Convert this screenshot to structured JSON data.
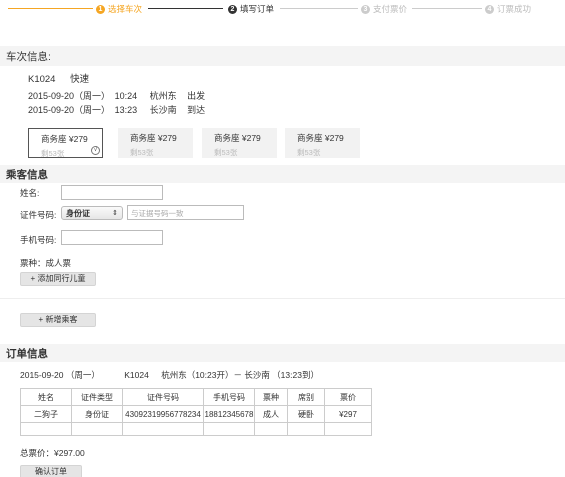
{
  "steps": [
    {
      "num": "1",
      "label": "选择车次",
      "state": "done"
    },
    {
      "num": "2",
      "label": "填写订单",
      "state": "active"
    },
    {
      "num": "3",
      "label": "支付票价",
      "state": "todo"
    },
    {
      "num": "4",
      "label": "订票成功",
      "state": "todo"
    }
  ],
  "colors": {
    "done": "#f5a623",
    "active": "#333333",
    "todo": "#cccccc"
  },
  "train": {
    "section_title": "车次信息:",
    "number": "K1024",
    "type": "快速",
    "depart_date": "2015-09-20（周一）",
    "depart_time": "10:24",
    "depart_station": "杭州东",
    "depart_action": "出发",
    "arrive_date": "2015-09-20（周一）",
    "arrive_time": "13:23",
    "arrive_station": "长沙南",
    "arrive_action": "到达"
  },
  "seats": [
    {
      "name": "商务座 ¥279",
      "remaining": "剩53张",
      "selected": true,
      "badge": "√"
    },
    {
      "name": "商务座 ¥279",
      "remaining": "剩53张"
    },
    {
      "name": "商务座 ¥279",
      "remaining": "剩53张"
    },
    {
      "name": "商务座 ¥279",
      "remaining": "剩53张"
    }
  ],
  "passenger": {
    "section_title": "乘客信息",
    "name_label": "姓名:",
    "name_value": "",
    "id_label": "证件号码:",
    "id_type": "身份证",
    "id_placeholder": "与证据号码一致",
    "phone_label": "手机号码:",
    "phone_value": "",
    "ticket_type": "票种：成人票",
    "add_child_button": "+ 添加同行儿童",
    "add_passenger_button": "+ 新增乘客"
  },
  "order": {
    "section_title": "订单信息",
    "summary_date": "2015-09-20 （周一）",
    "summary_train": "K1024",
    "summary_route": "杭州东（10:23开）－ 长沙南 （13:23到）",
    "headers": [
      "姓名",
      "证件类型",
      "证件号码",
      "手机号码",
      "票种",
      "席别",
      "票价"
    ],
    "rows": [
      [
        "二狗子",
        "身份证",
        "43092319956778234",
        "18812345678",
        "成人",
        "硬卧",
        "¥297"
      ]
    ],
    "total": "总票价：¥297.00",
    "confirm_button": "确认订单"
  }
}
